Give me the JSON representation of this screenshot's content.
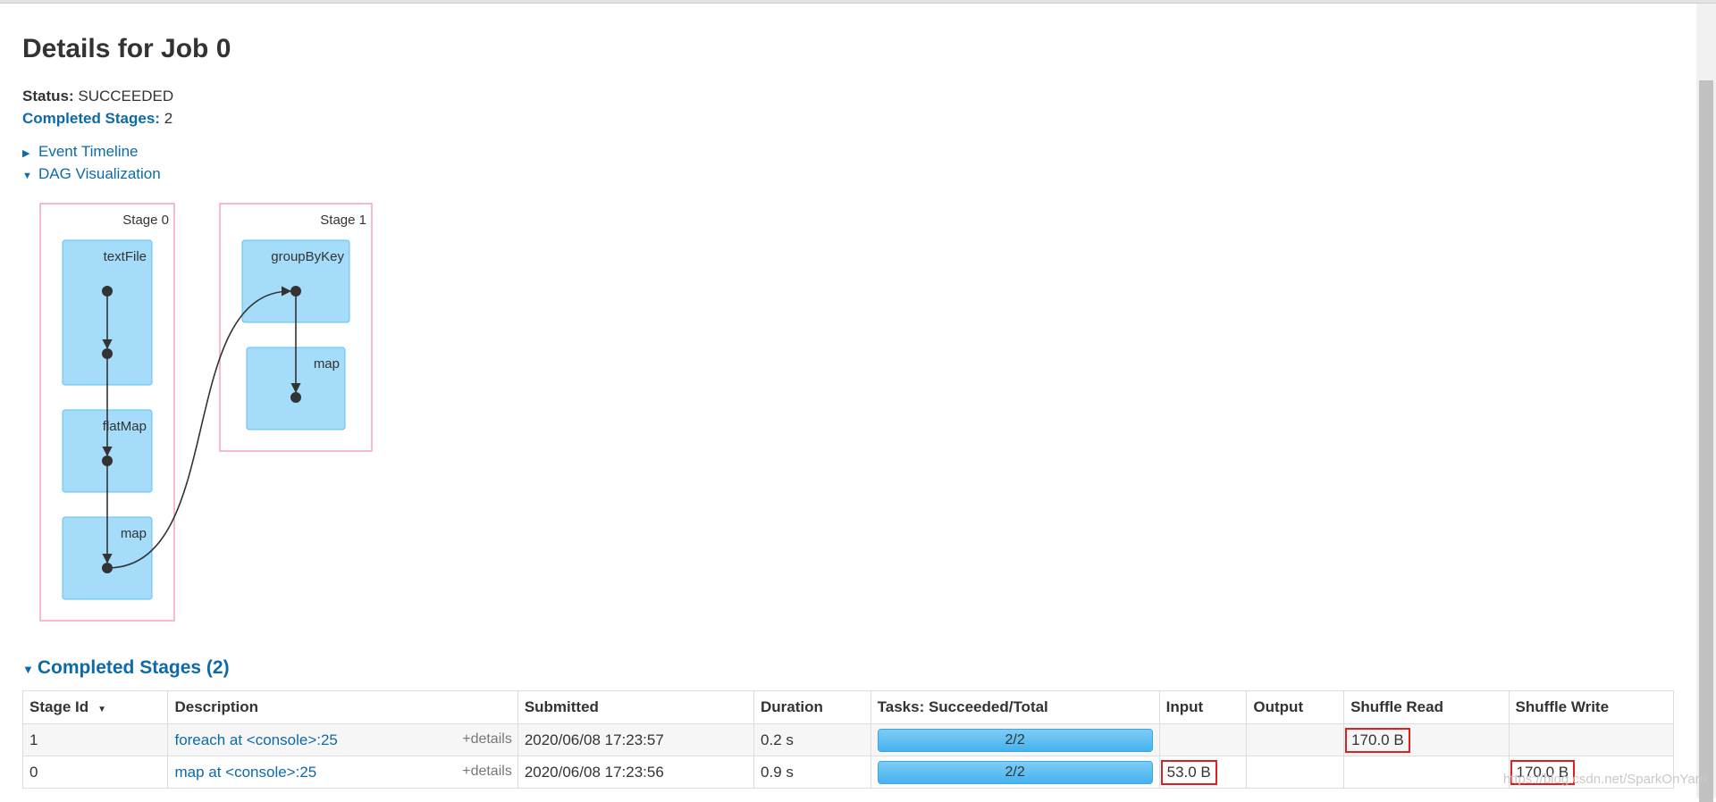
{
  "page": {
    "title": "Details for Job 0",
    "status_label": "Status:",
    "status_value": "SUCCEEDED",
    "completed_label": "Completed Stages:",
    "completed_value": "2",
    "event_timeline": "Event Timeline",
    "dag_visualization": "DAG Visualization"
  },
  "dag": {
    "stages": [
      {
        "label": "Stage 0",
        "ops": [
          "textFile",
          "flatMap",
          "map"
        ]
      },
      {
        "label": "Stage 1",
        "ops": [
          "groupByKey",
          "map"
        ]
      }
    ],
    "colors": {
      "stage_border": "#f4a3c4",
      "node_fill": "#a4dcf9",
      "node_border": "#5ec0f0",
      "edge": "#333333"
    }
  },
  "completed_stages": {
    "header": "Completed Stages (2)",
    "columns": [
      "Stage Id",
      "Description",
      "Submitted",
      "Duration",
      "Tasks: Succeeded/Total",
      "Input",
      "Output",
      "Shuffle Read",
      "Shuffle Write"
    ],
    "sort_indicator": "▼",
    "rows": [
      {
        "stage_id": "1",
        "description": "foreach at <console>:25",
        "details": "+details",
        "submitted": "2020/06/08 17:23:57",
        "duration": "0.2 s",
        "tasks": "2/2",
        "input": "",
        "output": "",
        "shuffle_read": "170.0 B",
        "shuffle_write": ""
      },
      {
        "stage_id": "0",
        "description": "map at <console>:25",
        "details": "+details",
        "submitted": "2020/06/08 17:23:56",
        "duration": "0.9 s",
        "tasks": "2/2",
        "input": "53.0 B",
        "output": "",
        "shuffle_read": "",
        "shuffle_write": "170.0 B"
      }
    ]
  },
  "watermark": "https://blog.csdn.net/SparkOnYarn",
  "colors": {
    "link": "#0d6aa8",
    "highlight": "#e02020",
    "progress": "#45b2ee"
  }
}
